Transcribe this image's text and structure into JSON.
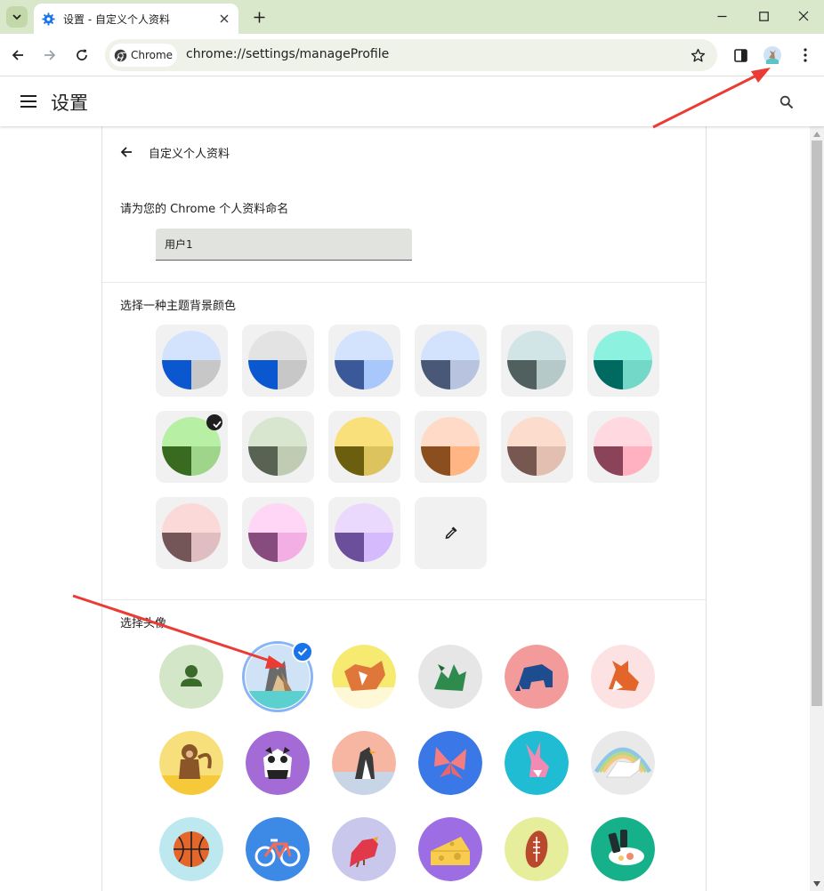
{
  "browser": {
    "tab_title": "设置 - 自定义个人资料",
    "chip_label": "Chrome",
    "url": "chrome://settings/manageProfile"
  },
  "settings": {
    "header_title": "设置",
    "page_title": "自定义个人资料",
    "name_label": "请为您的 Chrome 个人资料命名",
    "name_value": "用户1",
    "theme_label": "选择一种主题背景颜色",
    "avatar_label": "选择头像"
  },
  "themes": [
    {
      "top": "#d3e3fd",
      "left": "#0b57d0",
      "right": "#c7c7c7",
      "selected": false
    },
    {
      "top": "#e3e3e3",
      "left": "#0b57d0",
      "right": "#c7c7c7",
      "selected": false
    },
    {
      "top": "#d3e3fd",
      "left": "#3b5998",
      "right": "#a8c7fa",
      "selected": false
    },
    {
      "top": "#d3e3fd",
      "left": "#4a5878",
      "right": "#b7c3df",
      "selected": false
    },
    {
      "top": "#d2e5e6",
      "left": "#50605f",
      "right": "#b6c9c9",
      "selected": false
    },
    {
      "top": "#8cf2df",
      "left": "#006a60",
      "right": "#74d8c8",
      "selected": false
    },
    {
      "top": "#b7f0a4",
      "left": "#386a20",
      "right": "#9ed58a",
      "selected": true
    },
    {
      "top": "#d9e6cf",
      "left": "#586353",
      "right": "#bfcbb3",
      "selected": false
    },
    {
      "top": "#f9e07a",
      "left": "#6c5e0f",
      "right": "#dcc35e",
      "selected": false
    },
    {
      "top": "#ffdbc7",
      "left": "#8b4f1f",
      "right": "#ffb684",
      "selected": false
    },
    {
      "top": "#fcdccc",
      "left": "#775850",
      "right": "#e3bfb1",
      "selected": false
    },
    {
      "top": "#ffd9df",
      "left": "#8a4359",
      "right": "#ffb1c1",
      "selected": false
    },
    {
      "top": "#fbd9d9",
      "left": "#745558",
      "right": "#e0bdc0",
      "selected": false
    },
    {
      "top": "#ffd6f5",
      "left": "#874b7e",
      "right": "#f3afe4",
      "selected": false
    },
    {
      "top": "#ead9fd",
      "left": "#6b4f9b",
      "right": "#d5bafe",
      "selected": false
    }
  ],
  "custom_theme_icon": "eyedropper-icon",
  "avatars": [
    {
      "name": "avatar-generic-person",
      "bg": "#d4e6c8",
      "fg": "#3a6b2a",
      "kind": "person"
    },
    {
      "name": "avatar-origami-cat",
      "bg": "#cfe2f6",
      "fg": "#e1c08f",
      "kind": "cat",
      "selected": true
    },
    {
      "name": "avatar-origami-corgi",
      "bg": "#f6ea70",
      "fg": "#e0773a",
      "kind": "dog"
    },
    {
      "name": "avatar-origami-dragon",
      "bg": "#e6e6e6",
      "fg": "#2f8a4d",
      "kind": "dragon"
    },
    {
      "name": "avatar-origami-elephant",
      "bg": "#f39b9b",
      "fg": "#1d4d8e",
      "kind": "elephant"
    },
    {
      "name": "avatar-origami-fox",
      "bg": "#fce2e2",
      "fg": "#e2652a",
      "kind": "fox"
    },
    {
      "name": "avatar-origami-monkey",
      "bg": "#f7e07c",
      "fg": "#8a5528",
      "kind": "monkey"
    },
    {
      "name": "avatar-origami-panda",
      "bg": "#a46bd6",
      "fg": "#ffffff",
      "kind": "panda"
    },
    {
      "name": "avatar-origami-penguin",
      "bg": "#f6b6a2",
      "fg": "#3a3a3a",
      "kind": "penguin"
    },
    {
      "name": "avatar-origami-butterfly",
      "bg": "#3b78e7",
      "fg": "#f47d80",
      "kind": "butterfly"
    },
    {
      "name": "avatar-origami-rabbit",
      "bg": "#1fbcd4",
      "fg": "#f28bb4",
      "kind": "rabbit"
    },
    {
      "name": "avatar-origami-unicorn",
      "bg": "#e9e9e9",
      "fg": "#ffffff",
      "kind": "unicorn"
    },
    {
      "name": "avatar-basketball",
      "bg": "#bde8f0",
      "fg": "#e5662b",
      "kind": "basketball"
    },
    {
      "name": "avatar-bicycle",
      "bg": "#3d8ae6",
      "fg": "#f26c5c",
      "kind": "bicycle"
    },
    {
      "name": "avatar-bird",
      "bg": "#c9c7eb",
      "fg": "#e2394a",
      "kind": "bird"
    },
    {
      "name": "avatar-cheese",
      "bg": "#9d6ee3",
      "fg": "#f8cc4d",
      "kind": "cheese"
    },
    {
      "name": "avatar-football",
      "bg": "#e6ee9c",
      "fg": "#b8492d",
      "kind": "football"
    },
    {
      "name": "avatar-sushi",
      "bg": "#16b18a",
      "fg": "#ffffff",
      "kind": "sushi"
    }
  ]
}
